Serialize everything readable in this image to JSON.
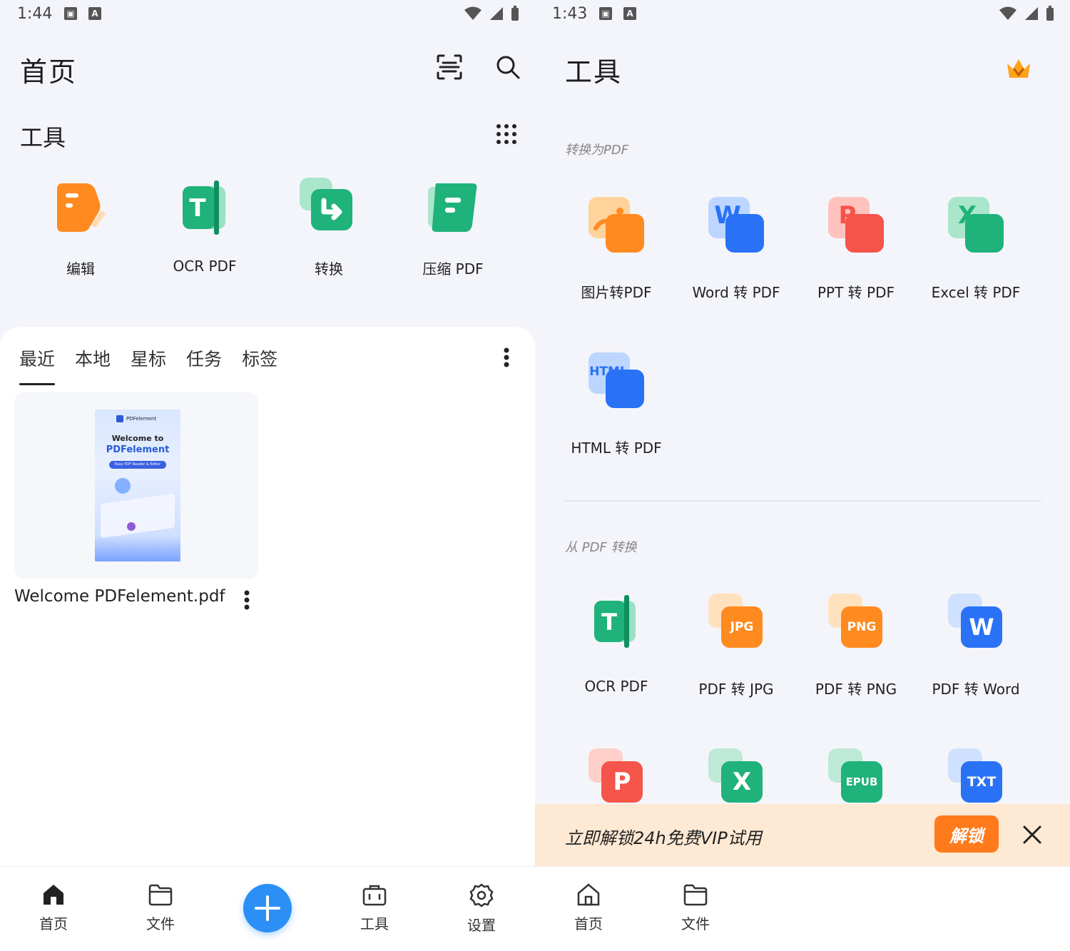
{
  "left": {
    "status": {
      "time": "1:44",
      "notif_icon_1": "image-icon",
      "notif_icon_2": "a-icon"
    },
    "title": "首页",
    "header_icons": [
      "scan-icon",
      "search-icon"
    ],
    "tools_section": {
      "title": "工具",
      "more_icon": "grid-dots-icon",
      "items": [
        {
          "label": "编辑",
          "icon": "edit-icon",
          "color": "#ff8a1f"
        },
        {
          "label": "OCR PDF",
          "icon": "ocr-icon",
          "color": "#1fb27a"
        },
        {
          "label": "转换",
          "icon": "convert-icon",
          "color": "#1fb27a"
        },
        {
          "label": "压缩 PDF",
          "icon": "compress-icon",
          "color": "#1fb27a"
        }
      ]
    },
    "files": {
      "tabs": [
        "最近",
        "本地",
        "星标",
        "任务",
        "标签"
      ],
      "active_tab": "最近",
      "items": [
        {
          "name": "Welcome PDFelement.pdf",
          "thumb_lines": [
            "PDFelement",
            "Welcome to",
            "PDFelement",
            "Easy PDF Reader & Editor"
          ]
        }
      ]
    }
  },
  "right": {
    "status": {
      "time": "1:43",
      "notif_icon_1": "image-icon",
      "notif_icon_2": "a-icon"
    },
    "title": "工具",
    "crown_icon": "crown-icon",
    "to_pdf": {
      "title": "转换为PDF",
      "items": [
        {
          "label": "图片转PDF",
          "icon": "image-to-pdf-icon",
          "color": "#ff8a1f",
          "glyph": ""
        },
        {
          "label": "Word 转 PDF",
          "icon": "word-to-pdf-icon",
          "color": "#2a72f5",
          "glyph": "W"
        },
        {
          "label": "PPT 转 PDF",
          "icon": "ppt-to-pdf-icon",
          "color": "#f5544a",
          "glyph": "P"
        },
        {
          "label": "Excel 转 PDF",
          "icon": "excel-to-pdf-icon",
          "color": "#1fb27a",
          "glyph": "X"
        },
        {
          "label": "HTML 转 PDF",
          "icon": "html-to-pdf-icon",
          "color": "#2a72f5",
          "glyph": "HTML"
        }
      ]
    },
    "from_pdf": {
      "title": "从 PDF 转换",
      "items": [
        {
          "label": "OCR PDF",
          "icon": "ocr-icon",
          "color": "#1fb27a",
          "glyph": "T"
        },
        {
          "label": "PDF 转 JPG",
          "icon": "pdf-to-jpg-icon",
          "color": "#ff8a1f",
          "glyph": "JPG"
        },
        {
          "label": "PDF 转 PNG",
          "icon": "pdf-to-png-icon",
          "color": "#ff8a1f",
          "glyph": "PNG"
        },
        {
          "label": "PDF 转 Word",
          "icon": "pdf-to-word-icon",
          "color": "#2a72f5",
          "glyph": "W"
        }
      ],
      "partial_items": [
        {
          "icon": "pdf-to-ppt-icon",
          "color": "#f5544a",
          "glyph": "P"
        },
        {
          "icon": "pdf-to-excel-icon",
          "color": "#1fb27a",
          "glyph": "X"
        },
        {
          "icon": "pdf-to-epub-icon",
          "color": "#1fb27a",
          "glyph": "EPUB"
        },
        {
          "icon": "pdf-to-txt-icon",
          "color": "#2a72f5",
          "glyph": "TXT"
        }
      ]
    },
    "promo": {
      "text": "立即解锁24h免费VIP试用",
      "button": "解锁"
    }
  },
  "nav": {
    "left": [
      {
        "label": "首页",
        "icon": "home-icon"
      },
      {
        "label": "文件",
        "icon": "folder-icon"
      },
      {
        "label": "",
        "icon": "plus-icon"
      },
      {
        "label": "工具",
        "icon": "toolbox-icon"
      },
      {
        "label": "设置",
        "icon": "gear-icon"
      }
    ],
    "right": [
      {
        "label": "首页",
        "icon": "home-icon"
      },
      {
        "label": "文件",
        "icon": "folder-icon"
      }
    ]
  }
}
